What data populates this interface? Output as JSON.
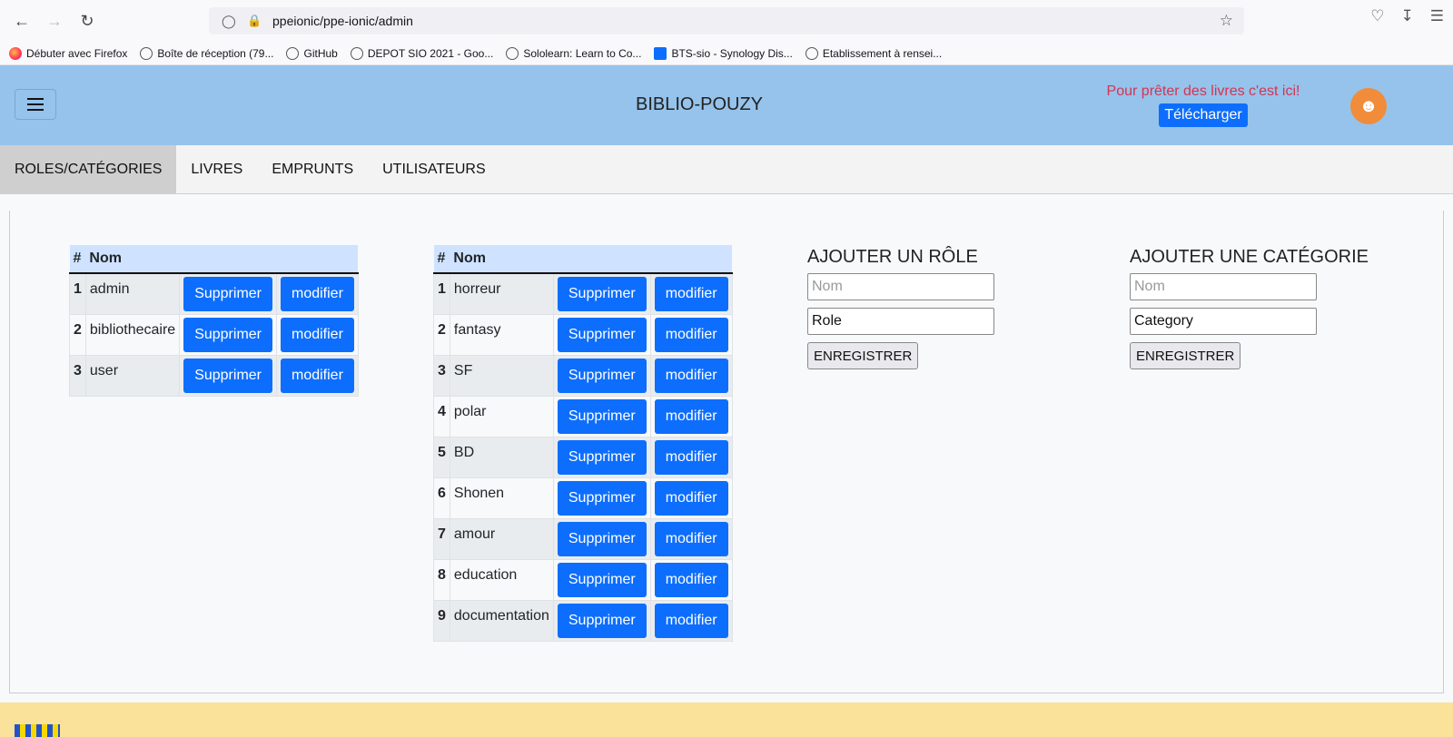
{
  "browser": {
    "url": "ppeionic/ppe-ionic/admin",
    "bookmarks": [
      "Débuter avec Firefox",
      "Boîte de réception (79...",
      "GitHub",
      "DEPOT SIO 2021 - Goo...",
      "Sololearn: Learn to Co...",
      "BTS-sio - Synology Dis...",
      "Etablissement à rensei..."
    ]
  },
  "header": {
    "title": "BIBLIO-POUZY",
    "promo_text": "Pour prêter des livres c'est ici!",
    "download_label": "Télécharger"
  },
  "tabs": [
    "ROLES/CATÉGORIES",
    "LIVRES",
    "EMPRUNTS",
    "UTILISATEURS"
  ],
  "roles_table": {
    "headers": [
      "#",
      "Nom"
    ],
    "rows": [
      {
        "num": "1",
        "name": "admin"
      },
      {
        "num": "2",
        "name": "bibliothecaire"
      },
      {
        "num": "3",
        "name": "user"
      }
    ]
  },
  "categories_table": {
    "headers": [
      "#",
      "Nom"
    ],
    "rows": [
      {
        "num": "1",
        "name": "horreur"
      },
      {
        "num": "2",
        "name": "fantasy"
      },
      {
        "num": "3",
        "name": "SF"
      },
      {
        "num": "4",
        "name": "polar"
      },
      {
        "num": "5",
        "name": "BD"
      },
      {
        "num": "6",
        "name": "Shonen"
      },
      {
        "num": "7",
        "name": "amour"
      },
      {
        "num": "8",
        "name": "education"
      },
      {
        "num": "9",
        "name": "documentation"
      }
    ]
  },
  "row_actions": {
    "delete_label": "Supprimer",
    "edit_label": "modifier"
  },
  "add_role": {
    "title": "AJOUTER UN RÔLE",
    "name_placeholder": "Nom",
    "type_value": "Role",
    "save_label": "ENREGISTRER"
  },
  "add_category": {
    "title": "AJOUTER UNE CATÉGORIE",
    "name_placeholder": "Nom",
    "type_value": "Category",
    "save_label": "ENREGISTRER"
  }
}
